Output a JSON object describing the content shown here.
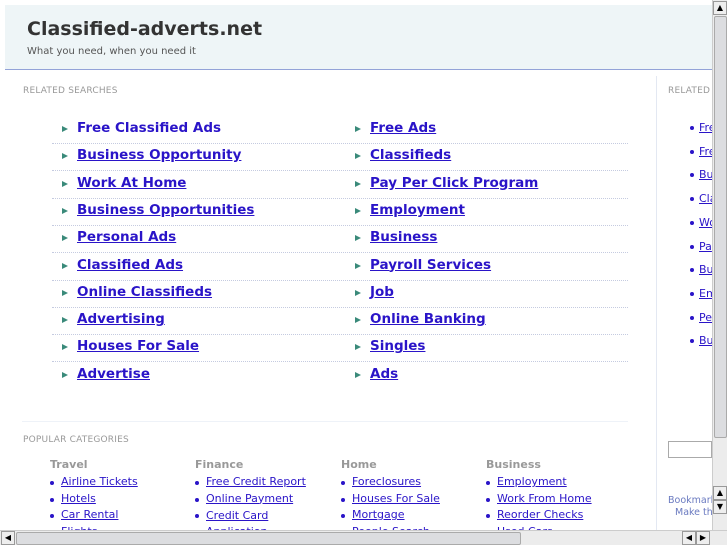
{
  "header": {
    "title": "Classified-adverts.net",
    "tagline": "What you need, when you need it"
  },
  "related_searches": {
    "label": "RELATED SEARCHES",
    "left": [
      "Free Classified Ads",
      "Business Opportunity",
      "Work At Home",
      "Business Opportunities",
      "Personal Ads",
      "Classified Ads",
      "Online Classifieds",
      "Advertising",
      "Houses For Sale",
      "Advertise"
    ],
    "right": [
      "Free Ads",
      "Classifieds",
      "Pay Per Click Program",
      "Employment",
      "Business",
      "Payroll Services",
      "Job",
      "Online Banking",
      "Singles",
      "Ads"
    ]
  },
  "popular": {
    "label": "POPULAR CATEGORIES",
    "columns": [
      {
        "title": "Travel",
        "items": [
          "Airline Tickets",
          "Hotels",
          "Car Rental",
          "Flights"
        ]
      },
      {
        "title": "Finance",
        "items": [
          "Free Credit Report",
          "Online Payment",
          "Credit Card Application"
        ]
      },
      {
        "title": "Home",
        "items": [
          "Foreclosures",
          "Houses For Sale",
          "Mortgage",
          "People Search"
        ]
      },
      {
        "title": "Business",
        "items": [
          "Employment",
          "Work From Home",
          "Reorder Checks",
          "Used Cars"
        ]
      }
    ]
  },
  "sidebar": {
    "label": "RELATED",
    "items": [
      "Fre",
      "Fre",
      "Bu",
      "Cla",
      "Wo",
      "Pa",
      "Bu",
      "Em",
      "Pe",
      "Bu"
    ],
    "bookmark": "Bookmark",
    "make": "Make thi"
  },
  "colors": {
    "link": "#2a14c8",
    "arrow": "#3a8a7a",
    "header_bg": "#eef5f7"
  }
}
